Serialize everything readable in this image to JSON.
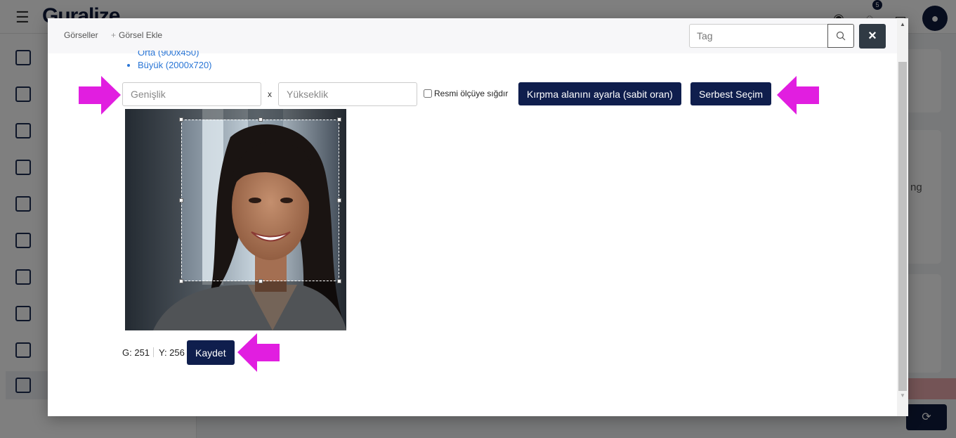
{
  "background": {
    "logo_text": "Guralize",
    "notification_count": "5"
  },
  "modal": {
    "breadcrumb": {
      "item1": "Görseller",
      "item2": "Görsel Ekle"
    },
    "tag_input": {
      "placeholder": "Tag",
      "value": ""
    },
    "size_options": [
      "Orta (900x450)",
      "Büyük (2000x720)"
    ],
    "width_input": {
      "placeholder": "Genişlik",
      "value": ""
    },
    "separator": "x",
    "height_input": {
      "placeholder": "Yükseklik",
      "value": ""
    },
    "fit_checkbox": {
      "label": "Resmi ölçüye sığdır",
      "checked": false
    },
    "crop_fixed_button": "Kırpma alanını ayarla (sabit oran)",
    "free_select_button": "Serbest Seçim",
    "dimensions": {
      "width_text": "G: 251",
      "height_text": "Y: 256"
    },
    "save_button": "Kaydet",
    "close_icon": "×"
  },
  "colors": {
    "primary": "#0f1e4d",
    "close_bg": "#303a44",
    "link": "#2a76d6",
    "arrow": "#e11ee0"
  },
  "icons": [
    "menu-icon",
    "search-icon",
    "close-icon",
    "arrow-right-icon",
    "arrow-left-icon",
    "eye-icon",
    "chat-icon",
    "book-icon",
    "user-icon",
    "refresh-icon"
  ]
}
